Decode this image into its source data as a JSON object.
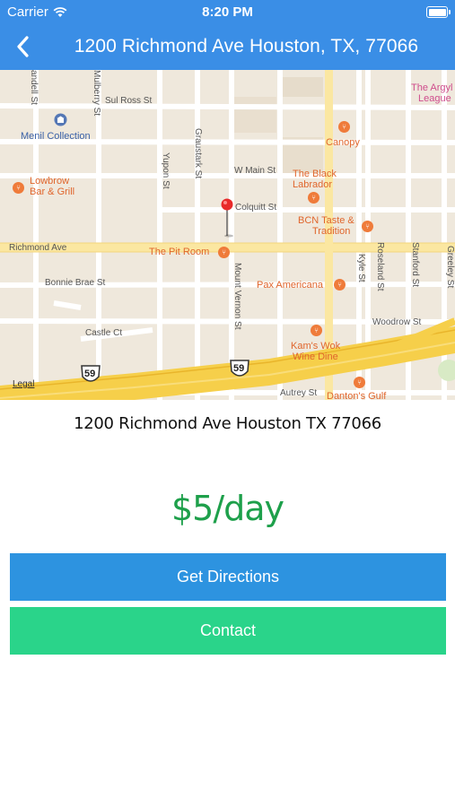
{
  "status_bar": {
    "carrier": "Carrier",
    "time": "8:20 PM"
  },
  "nav": {
    "title": "1200 Richmond Ave  Houston, TX, 77066"
  },
  "map": {
    "streets": {
      "sul_ross": "Sul Ross St",
      "mulberry": "Mulberry St",
      "yupon": "Yupon St",
      "graustark": "Graustark St",
      "w_main": "W Main St",
      "colquitt": "Colquitt St",
      "richmond": "Richmond Ave",
      "bonnie_brae": "Bonnie Brae St",
      "castle": "Castle Ct",
      "mount_vernon": "Mount Vernon St",
      "kyle": "Kyle St",
      "roseland": "Roseland St",
      "stanford": "Stanford St",
      "greeley": "Greeley St",
      "woodrow": "Woodrow St",
      "autrey": "Autrey St",
      "mandell": "andell St"
    },
    "pois": {
      "menil": "Menil Collection",
      "lowbrow_1": "Lowbrow",
      "lowbrow_2": "Bar & Grill",
      "canopy": "Canopy",
      "black_lab_1": "The Black",
      "black_lab_2": "Labrador",
      "bcn_1": "BCN Taste &",
      "bcn_2": "Tradition",
      "pit_room": "The Pit Room",
      "pax": "Pax Americana",
      "kams_1": "Kam's Wok",
      "kams_2": "Wine Dine",
      "argyle_1": "The Argyl",
      "argyle_2": "League",
      "danton": "Danton's Gulf"
    },
    "highway_shield": "59",
    "legal": "Legal"
  },
  "details": {
    "address": "1200 Richmond Ave  Houston TX 77066",
    "price": "$5/day"
  },
  "actions": {
    "directions_label": "Get Directions",
    "contact_label": "Contact"
  },
  "colors": {
    "nav_bar": "#3a8ee6",
    "price": "#1ea04b",
    "directions_button": "#2d93e0",
    "contact_button": "#2ad48a"
  }
}
